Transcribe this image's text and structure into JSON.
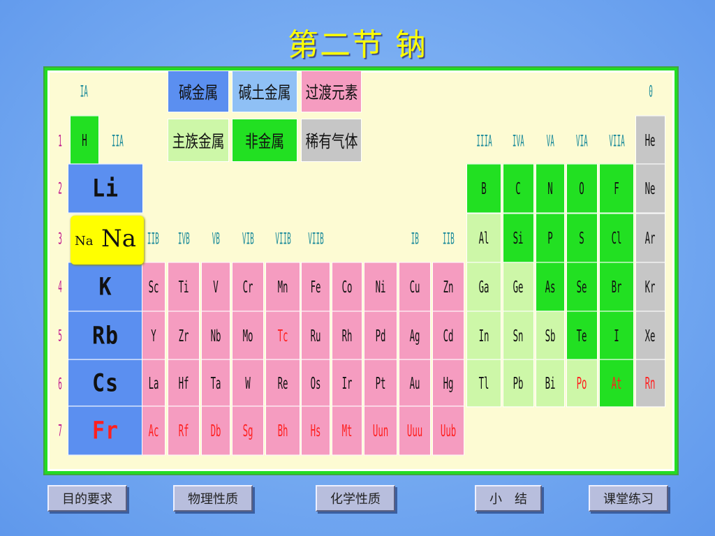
{
  "title": "第二节  钠",
  "colors": {
    "alkali": "#5b8ff0",
    "alkaline_earth": "#8fc0f5",
    "transition": "#f59cc0",
    "main_group_metal": "#cdf7a8",
    "nonmetal": "#22e022",
    "noble_gas": "#c6c6c6",
    "red_text": "#ff2020"
  },
  "legend": {
    "alkali": "碱金属",
    "alkaline_earth": "碱土金属",
    "transition": "过渡元素",
    "main_group_metal": "主族金属",
    "nonmetal": "非金属",
    "noble_gas": "稀有气体"
  },
  "group_labels": {
    "IA": "IA",
    "IIA": "IIA",
    "IIIA": "IIIA",
    "IVA": "IVA",
    "VA": "VA",
    "VIA": "VIA",
    "VIIA": "VIIA",
    "zero": "0",
    "IIIB": "IIB",
    "IVB": "IVB",
    "VB": "VB",
    "VIB": "VIB",
    "VIIB": "VIIB",
    "VIIIB": "VIIB",
    "IB": "IB",
    "IIB": "IIB"
  },
  "periods": [
    "1",
    "2",
    "3",
    "4",
    "5",
    "6",
    "7"
  ],
  "elements": {
    "H": "H",
    "He": "He",
    "Li": "Li",
    "B": "B",
    "C": "C",
    "N": "N",
    "O": "O",
    "F": "F",
    "Ne": "Ne",
    "Al": "Al",
    "Si": "Si",
    "P": "P",
    "S": "S",
    "Cl": "Cl",
    "Ar": "Ar",
    "K": "K",
    "Sc": "Sc",
    "Ti": "Ti",
    "V": "V",
    "Cr": "Cr",
    "Mn": "Mn",
    "Fe": "Fe",
    "Co": "Co",
    "Ni": "Ni",
    "Cu": "Cu",
    "Zn": "Zn",
    "Ga": "Ga",
    "Ge": "Ge",
    "As": "As",
    "Se": "Se",
    "Br": "Br",
    "Kr": "Kr",
    "Rb": "Rb",
    "Y": "Y",
    "Zr": "Zr",
    "Nb": "Nb",
    "Mo": "Mo",
    "Tc": "Tc",
    "Ru": "Ru",
    "Rh": "Rh",
    "Pd": "Pd",
    "Ag": "Ag",
    "Cd": "Cd",
    "In": "In",
    "Sn": "Sn",
    "Sb": "Sb",
    "Te": "Te",
    "I": "I",
    "Xe": "Xe",
    "Cs": "Cs",
    "La": "La",
    "Hf": "Hf",
    "Ta": "Ta",
    "W": "W",
    "Re": "Re",
    "Os": "Os",
    "Ir": "Ir",
    "Pt": "Pt",
    "Au": "Au",
    "Hg": "Hg",
    "Tl": "Tl",
    "Pb": "Pb",
    "Bi": "Bi",
    "Po": "Po",
    "At": "At",
    "Rn": "Rn",
    "Fr": "Fr",
    "Ac": "Ac",
    "Rf": "Rf",
    "Db": "Db",
    "Sg": "Sg",
    "Bh": "Bh",
    "Hs": "Hs",
    "Mt": "Mt",
    "Uun": "Uun",
    "Uuu": "Uuu",
    "Uub": "Uub"
  },
  "na_highlight": {
    "small": "Na",
    "big": "Na"
  },
  "nav": {
    "objectives": "目的要求",
    "physical": "物理性质",
    "chemical": "化学性质",
    "summary": "小　结",
    "exercise": "课堂练习"
  }
}
